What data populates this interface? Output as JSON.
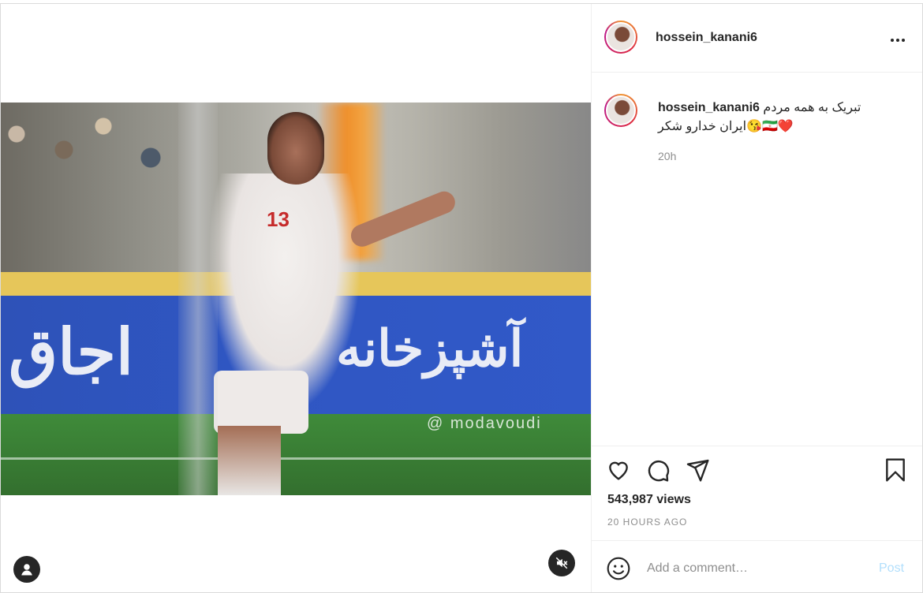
{
  "post": {
    "username": "hossein_kanani6",
    "caption_line1": "تبریک به همه مردم",
    "caption_line2": "ایران خدارو شکر😘🇮🇷❤️",
    "caption_time": "20h",
    "views": "543,987 views",
    "posted_ago": "20 HOURS AGO"
  },
  "media": {
    "watermark": "@ modavoudi",
    "ad_left": "اجاق",
    "ad_right": "آشپزخانه",
    "jersey_number": "13"
  },
  "comment": {
    "placeholder": "Add a comment…",
    "post_label": "Post"
  },
  "icons": {
    "more": "more-options-icon",
    "like": "heart-icon",
    "comment": "comment-icon",
    "share": "share-icon",
    "save": "bookmark-icon",
    "emoji": "emoji-icon",
    "mute": "speaker-muted-icon",
    "tags": "user-tag-icon"
  },
  "colors": {
    "text": "#262626",
    "muted": "#8e8e8e",
    "post_disabled": "#b2dffc",
    "border": "#dbdbdb"
  }
}
